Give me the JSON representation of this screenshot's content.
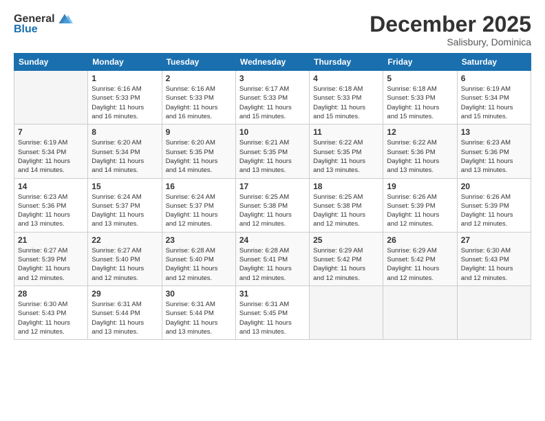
{
  "logo": {
    "general": "General",
    "blue": "Blue"
  },
  "title": "December 2025",
  "location": "Salisbury, Dominica",
  "weekdays": [
    "Sunday",
    "Monday",
    "Tuesday",
    "Wednesday",
    "Thursday",
    "Friday",
    "Saturday"
  ],
  "weeks": [
    [
      {
        "day": "",
        "info": ""
      },
      {
        "day": "1",
        "info": "Sunrise: 6:16 AM\nSunset: 5:33 PM\nDaylight: 11 hours\nand 16 minutes."
      },
      {
        "day": "2",
        "info": "Sunrise: 6:16 AM\nSunset: 5:33 PM\nDaylight: 11 hours\nand 16 minutes."
      },
      {
        "day": "3",
        "info": "Sunrise: 6:17 AM\nSunset: 5:33 PM\nDaylight: 11 hours\nand 15 minutes."
      },
      {
        "day": "4",
        "info": "Sunrise: 6:18 AM\nSunset: 5:33 PM\nDaylight: 11 hours\nand 15 minutes."
      },
      {
        "day": "5",
        "info": "Sunrise: 6:18 AM\nSunset: 5:33 PM\nDaylight: 11 hours\nand 15 minutes."
      },
      {
        "day": "6",
        "info": "Sunrise: 6:19 AM\nSunset: 5:34 PM\nDaylight: 11 hours\nand 15 minutes."
      }
    ],
    [
      {
        "day": "7",
        "info": "Sunrise: 6:19 AM\nSunset: 5:34 PM\nDaylight: 11 hours\nand 14 minutes."
      },
      {
        "day": "8",
        "info": "Sunrise: 6:20 AM\nSunset: 5:34 PM\nDaylight: 11 hours\nand 14 minutes."
      },
      {
        "day": "9",
        "info": "Sunrise: 6:20 AM\nSunset: 5:35 PM\nDaylight: 11 hours\nand 14 minutes."
      },
      {
        "day": "10",
        "info": "Sunrise: 6:21 AM\nSunset: 5:35 PM\nDaylight: 11 hours\nand 13 minutes."
      },
      {
        "day": "11",
        "info": "Sunrise: 6:22 AM\nSunset: 5:35 PM\nDaylight: 11 hours\nand 13 minutes."
      },
      {
        "day": "12",
        "info": "Sunrise: 6:22 AM\nSunset: 5:36 PM\nDaylight: 11 hours\nand 13 minutes."
      },
      {
        "day": "13",
        "info": "Sunrise: 6:23 AM\nSunset: 5:36 PM\nDaylight: 11 hours\nand 13 minutes."
      }
    ],
    [
      {
        "day": "14",
        "info": "Sunrise: 6:23 AM\nSunset: 5:36 PM\nDaylight: 11 hours\nand 13 minutes."
      },
      {
        "day": "15",
        "info": "Sunrise: 6:24 AM\nSunset: 5:37 PM\nDaylight: 11 hours\nand 13 minutes."
      },
      {
        "day": "16",
        "info": "Sunrise: 6:24 AM\nSunset: 5:37 PM\nDaylight: 11 hours\nand 12 minutes."
      },
      {
        "day": "17",
        "info": "Sunrise: 6:25 AM\nSunset: 5:38 PM\nDaylight: 11 hours\nand 12 minutes."
      },
      {
        "day": "18",
        "info": "Sunrise: 6:25 AM\nSunset: 5:38 PM\nDaylight: 11 hours\nand 12 minutes."
      },
      {
        "day": "19",
        "info": "Sunrise: 6:26 AM\nSunset: 5:39 PM\nDaylight: 11 hours\nand 12 minutes."
      },
      {
        "day": "20",
        "info": "Sunrise: 6:26 AM\nSunset: 5:39 PM\nDaylight: 11 hours\nand 12 minutes."
      }
    ],
    [
      {
        "day": "21",
        "info": "Sunrise: 6:27 AM\nSunset: 5:39 PM\nDaylight: 11 hours\nand 12 minutes."
      },
      {
        "day": "22",
        "info": "Sunrise: 6:27 AM\nSunset: 5:40 PM\nDaylight: 11 hours\nand 12 minutes."
      },
      {
        "day": "23",
        "info": "Sunrise: 6:28 AM\nSunset: 5:40 PM\nDaylight: 11 hours\nand 12 minutes."
      },
      {
        "day": "24",
        "info": "Sunrise: 6:28 AM\nSunset: 5:41 PM\nDaylight: 11 hours\nand 12 minutes."
      },
      {
        "day": "25",
        "info": "Sunrise: 6:29 AM\nSunset: 5:42 PM\nDaylight: 11 hours\nand 12 minutes."
      },
      {
        "day": "26",
        "info": "Sunrise: 6:29 AM\nSunset: 5:42 PM\nDaylight: 11 hours\nand 12 minutes."
      },
      {
        "day": "27",
        "info": "Sunrise: 6:30 AM\nSunset: 5:43 PM\nDaylight: 11 hours\nand 12 minutes."
      }
    ],
    [
      {
        "day": "28",
        "info": "Sunrise: 6:30 AM\nSunset: 5:43 PM\nDaylight: 11 hours\nand 12 minutes."
      },
      {
        "day": "29",
        "info": "Sunrise: 6:31 AM\nSunset: 5:44 PM\nDaylight: 11 hours\nand 13 minutes."
      },
      {
        "day": "30",
        "info": "Sunrise: 6:31 AM\nSunset: 5:44 PM\nDaylight: 11 hours\nand 13 minutes."
      },
      {
        "day": "31",
        "info": "Sunrise: 6:31 AM\nSunset: 5:45 PM\nDaylight: 11 hours\nand 13 minutes."
      },
      {
        "day": "",
        "info": ""
      },
      {
        "day": "",
        "info": ""
      },
      {
        "day": "",
        "info": ""
      }
    ]
  ]
}
